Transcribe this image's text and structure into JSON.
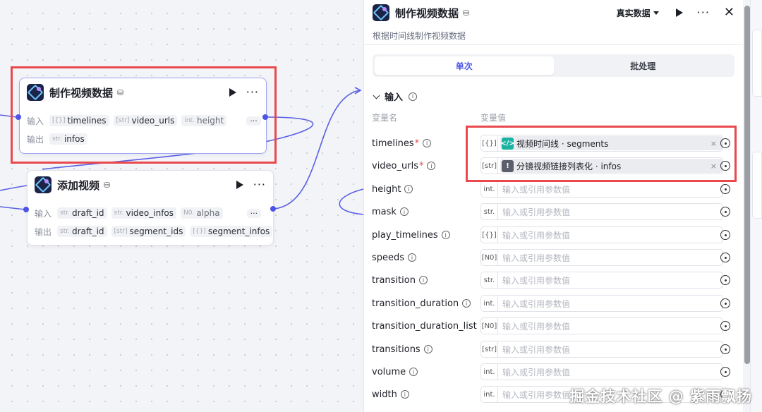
{
  "canvas": {
    "node1": {
      "title": "制作视频数据",
      "input_label": "输入",
      "output_label": "输出",
      "inputs": [
        {
          "type": "[{}]",
          "name": "timelines"
        },
        {
          "type": "[str]",
          "name": "video_urls"
        },
        {
          "type": "int.",
          "name": "height"
        }
      ],
      "outputs": [
        {
          "type": "str.",
          "name": "infos"
        }
      ],
      "more": "···"
    },
    "node2": {
      "title": "添加视频",
      "input_label": "输入",
      "output_label": "输出",
      "inputs": [
        {
          "type": "str.",
          "name": "draft_id"
        },
        {
          "type": "str.",
          "name": "video_infos"
        },
        {
          "type": "N0.",
          "name": "alpha"
        }
      ],
      "outputs": [
        {
          "type": "str.",
          "name": "draft_id"
        },
        {
          "type": "[str]",
          "name": "segment_ids"
        },
        {
          "type": "[{}]",
          "name": "segment_infos"
        }
      ],
      "more": "···"
    }
  },
  "panel": {
    "title": "制作视频数据",
    "description": "根据时间线制作视频数据",
    "mode": "真实数据",
    "tabs": [
      {
        "label": "单次",
        "active": true
      },
      {
        "label": "批处理",
        "active": false
      }
    ],
    "section_title": "输入",
    "col_name": "变量名",
    "col_value": "变量值",
    "params": [
      {
        "name": "timelines",
        "required": true,
        "type": "[{}]",
        "ref": {
          "text": "视频时间线 · segments",
          "icon": "</>",
          "icon_color": "#19b3a1"
        }
      },
      {
        "name": "video_urls",
        "required": true,
        "type": "[str]",
        "ref": {
          "text": "分镜视频链接列表化 · infos",
          "icon": "!",
          "icon_color": "#5b5f6b"
        }
      },
      {
        "name": "height",
        "required": false,
        "type": "int.",
        "placeholder": "输入或引用参数值"
      },
      {
        "name": "mask",
        "required": false,
        "type": "str.",
        "placeholder": "输入或引用参数值"
      },
      {
        "name": "play_timelines",
        "required": false,
        "type": "[{}]",
        "placeholder": "输入或引用参数值"
      },
      {
        "name": "speeds",
        "required": false,
        "type": "[N0]",
        "placeholder": "输入或引用参数值"
      },
      {
        "name": "transition",
        "required": false,
        "type": "str.",
        "placeholder": "输入或引用参数值"
      },
      {
        "name": "transition_duration",
        "required": false,
        "type": "int.",
        "placeholder": "输入或引用参数值"
      },
      {
        "name": "transition_duration_list",
        "required": false,
        "type": "[N0]",
        "placeholder": "输入或引用参数值"
      },
      {
        "name": "transitions",
        "required": false,
        "type": "[str]",
        "placeholder": "输入或引用参数值"
      },
      {
        "name": "volume",
        "required": false,
        "type": "int.",
        "placeholder": "输入或引用参数值"
      },
      {
        "name": "width",
        "required": false,
        "type": "int.",
        "placeholder": "输入或引用参数值"
      }
    ]
  },
  "watermark": "掘金技术社区 @ 紫雨飘扬",
  "colors": {
    "accent": "#4d53e8",
    "highlight": "#e9494d",
    "teal": "#19b3a1"
  }
}
